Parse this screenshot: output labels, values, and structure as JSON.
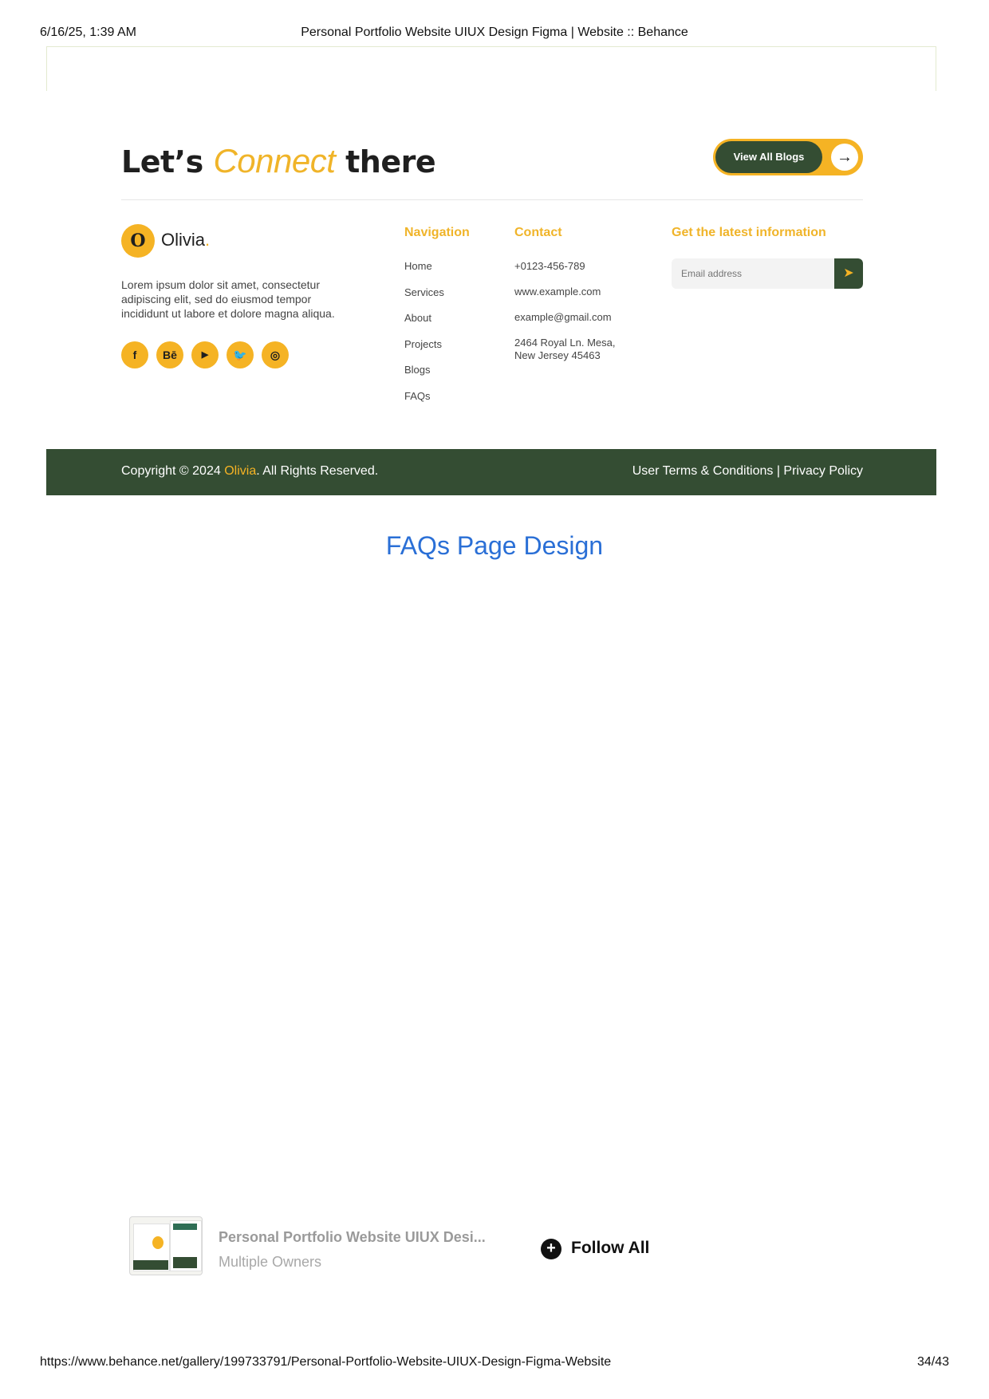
{
  "print_header": {
    "date": "6/16/25, 1:39 AM",
    "title": "Personal Portfolio Website UIUX Design Figma | Website :: Behance"
  },
  "print_footer": {
    "url": "https://www.behance.net/gallery/199733791/Personal-Portfolio-Website-UIUX-Design-Figma-Website",
    "page": "34/43"
  },
  "connect": {
    "heading_before": "Let’s",
    "heading_accent": "Connect",
    "heading_after": "there",
    "blogs_button": "View All Blogs",
    "arrow_icon": "arrow-right-icon"
  },
  "brand": {
    "logo_letter": "O",
    "name": "Olivia",
    "dot": ".",
    "about": "Lorem ipsum dolor sit amet, consectetur adipiscing elit, sed do eiusmod tempor incididunt ut labore et dolore magna aliqua.",
    "accent_color": "#f5b324",
    "dark_color": "#344d33"
  },
  "socials": [
    {
      "icon": "facebook-icon",
      "glyph": "f"
    },
    {
      "icon": "behance-icon",
      "glyph": "Bē"
    },
    {
      "icon": "youtube-icon",
      "glyph": "▶"
    },
    {
      "icon": "twitter-icon",
      "glyph": "🐦"
    },
    {
      "icon": "instagram-icon",
      "glyph": "◎"
    }
  ],
  "navigation": {
    "heading": "Navigation",
    "items": [
      "Home",
      "Services",
      "About",
      "Projects",
      "Blogs",
      "FAQs"
    ]
  },
  "contact": {
    "heading": "Contact",
    "phone": "+0123-456-789",
    "website": "www.example.com",
    "email": "example@gmail.com",
    "address": "2464 Royal Ln. Mesa, New Jersey 45463"
  },
  "newsletter": {
    "heading": "Get the latest information",
    "placeholder": "Email address",
    "send_icon": "send-icon"
  },
  "copyright": {
    "prefix": "Copyright © 2024",
    "brand": "Olivia",
    "suffix": ". All Rights Reserved.",
    "terms": "User Terms & Conditions",
    "separator": "|",
    "privacy": "Privacy Policy"
  },
  "section_title": "FAQs Page Design",
  "project": {
    "title": "Personal Portfolio Website UIUX Desi...",
    "owner": "Multiple Owners",
    "follow_label": "Follow All"
  }
}
